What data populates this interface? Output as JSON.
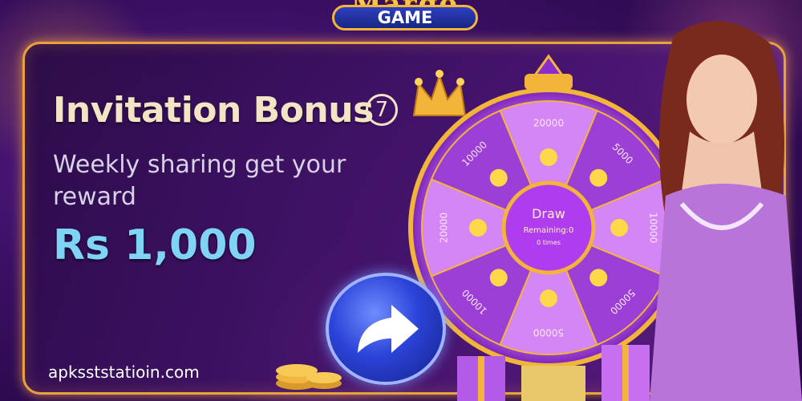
{
  "logo": {
    "top_text": "Margo",
    "bottom_text": "GAME"
  },
  "promo": {
    "title": "Invitation Bonus",
    "badge": "7",
    "subtitle": "Weekly sharing get your reward",
    "amount": "Rs 1,000"
  },
  "wheel": {
    "segments": [
      "20000",
      "5000",
      "10000",
      "50000",
      "50000",
      "10000",
      "20000",
      "10000"
    ],
    "center_title": "Draw",
    "center_line2": "Remaining:0",
    "center_line3": "0 times"
  },
  "watermark": "apksststatioin.com",
  "icons": {
    "arrow": "share-arrow-icon",
    "crown": "crown-icon"
  },
  "colors": {
    "accent_gold": "#e9a23b",
    "amount_blue": "#7fd4f6",
    "wheel_purple": "#9b3fd6",
    "button_blue": "#2b43d8"
  }
}
